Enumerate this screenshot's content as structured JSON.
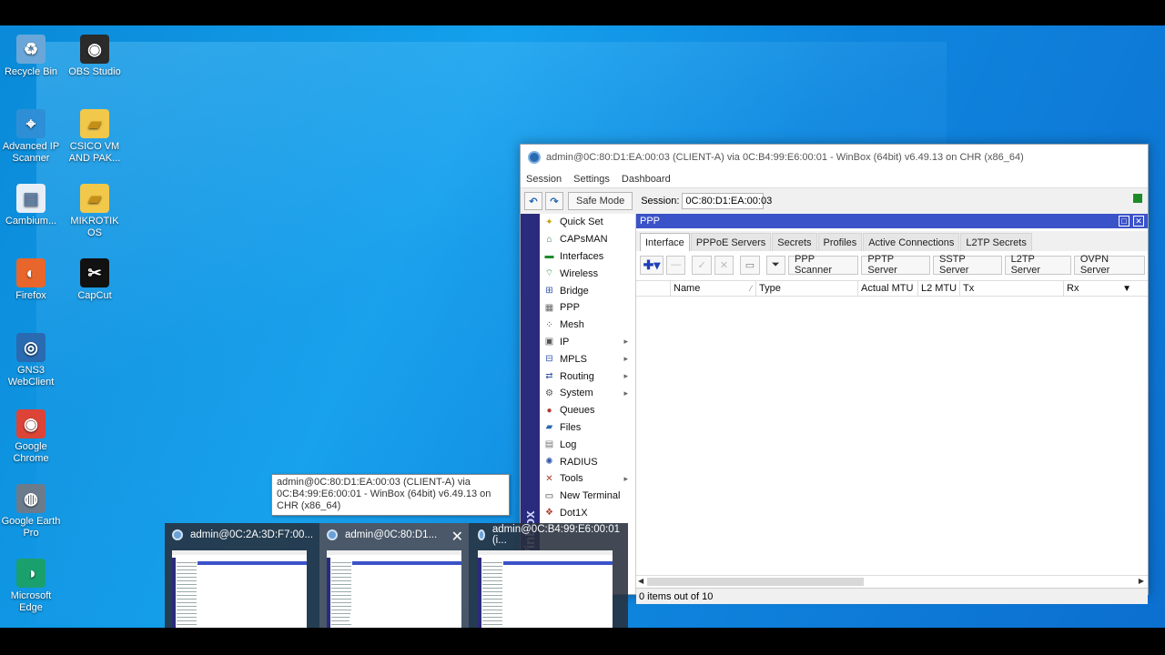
{
  "desktop_icons": [
    {
      "label": "Recycle Bin",
      "icon": "recycle-bin-icon",
      "color": "#6aa7d8"
    },
    {
      "label": "OBS Studio",
      "icon": "obs-icon",
      "color": "#2b2b2b"
    },
    {
      "label": "Advanced IP Scanner",
      "icon": "ip-scanner-icon",
      "color": "#2e8fd6"
    },
    {
      "label": "CSICO VM AND PAK...",
      "icon": "folder-icon",
      "color": "#f2c84b"
    },
    {
      "label": "Cambium...",
      "icon": "file-icon",
      "color": "#e8eef5"
    },
    {
      "label": "MIKROTIK OS",
      "icon": "folder-icon",
      "color": "#f2c84b"
    },
    {
      "label": "Firefox",
      "icon": "firefox-icon",
      "color": "#e8662b"
    },
    {
      "label": "CapCut",
      "icon": "capcut-icon",
      "color": "#111111"
    },
    {
      "label": "GNS3 WebClient",
      "icon": "gns3-icon",
      "color": "#2a6ab0"
    },
    {
      "label": "Google Chrome",
      "icon": "chrome-icon",
      "color": "#db4437"
    },
    {
      "label": "Google Earth Pro",
      "icon": "earth-icon",
      "color": "#6b7b8c"
    },
    {
      "label": "Microsoft Edge",
      "icon": "edge-icon",
      "color": "#1aa06d"
    }
  ],
  "winbox": {
    "title": "admin@0C:80:D1:EA:00:03 (CLIENT-A) via 0C:B4:99:E6:00:01 - WinBox (64bit) v6.49.13 on CHR (x86_64)",
    "menu": [
      "Session",
      "Settings",
      "Dashboard"
    ],
    "safe_mode": "Safe Mode",
    "session_label": "Session:",
    "session_value": "0C:80:D1:EA:00:03",
    "side_label": "OS WinBox",
    "sidebar": [
      {
        "label": "Quick Set",
        "icon": "wand-icon",
        "sub": false
      },
      {
        "label": "CAPsMAN",
        "icon": "antenna-icon",
        "sub": false
      },
      {
        "label": "Interfaces",
        "icon": "interfaces-icon",
        "sub": false
      },
      {
        "label": "Wireless",
        "icon": "wireless-icon",
        "sub": false
      },
      {
        "label": "Bridge",
        "icon": "bridge-icon",
        "sub": false
      },
      {
        "label": "PPP",
        "icon": "ppp-icon",
        "sub": false
      },
      {
        "label": "Mesh",
        "icon": "mesh-icon",
        "sub": false
      },
      {
        "label": "IP",
        "icon": "ip-icon",
        "sub": true
      },
      {
        "label": "MPLS",
        "icon": "mpls-icon",
        "sub": true
      },
      {
        "label": "Routing",
        "icon": "routing-icon",
        "sub": true
      },
      {
        "label": "System",
        "icon": "gear-icon",
        "sub": true
      },
      {
        "label": "Queues",
        "icon": "queues-icon",
        "sub": false
      },
      {
        "label": "Files",
        "icon": "folder-icon",
        "sub": false
      },
      {
        "label": "Log",
        "icon": "log-icon",
        "sub": false
      },
      {
        "label": "RADIUS",
        "icon": "radius-icon",
        "sub": false
      },
      {
        "label": "Tools",
        "icon": "tools-icon",
        "sub": true
      },
      {
        "label": "New Terminal",
        "icon": "terminal-icon",
        "sub": false
      },
      {
        "label": "Dot1X",
        "icon": "dot1x-icon",
        "sub": false
      }
    ],
    "ppp": {
      "title": "PPP",
      "tabs": [
        "Interface",
        "PPPoE Servers",
        "Secrets",
        "Profiles",
        "Active Connections",
        "L2TP Secrets"
      ],
      "active_tab": 0,
      "buttons": [
        "PPP Scanner",
        "PPTP Server",
        "SSTP Server",
        "L2TP Server",
        "OVPN Server"
      ],
      "columns": [
        "Name",
        "Type",
        "Actual MTU",
        "L2 MTU",
        "Tx",
        "Rx"
      ],
      "status": "0 items out of 10"
    }
  },
  "tooltip": "admin@0C:80:D1:EA:00:03 (CLIENT-A) via 0C:B4:99:E6:00:01 - WinBox (64bit) v6.49.13 on CHR (x86_64)",
  "previews": [
    {
      "title": "admin@0C:2A:3D:F7:00..."
    },
    {
      "title": "admin@0C:80:D1..."
    },
    {
      "title": "admin@0C:B4:99:E6:00:01 (i..."
    }
  ]
}
